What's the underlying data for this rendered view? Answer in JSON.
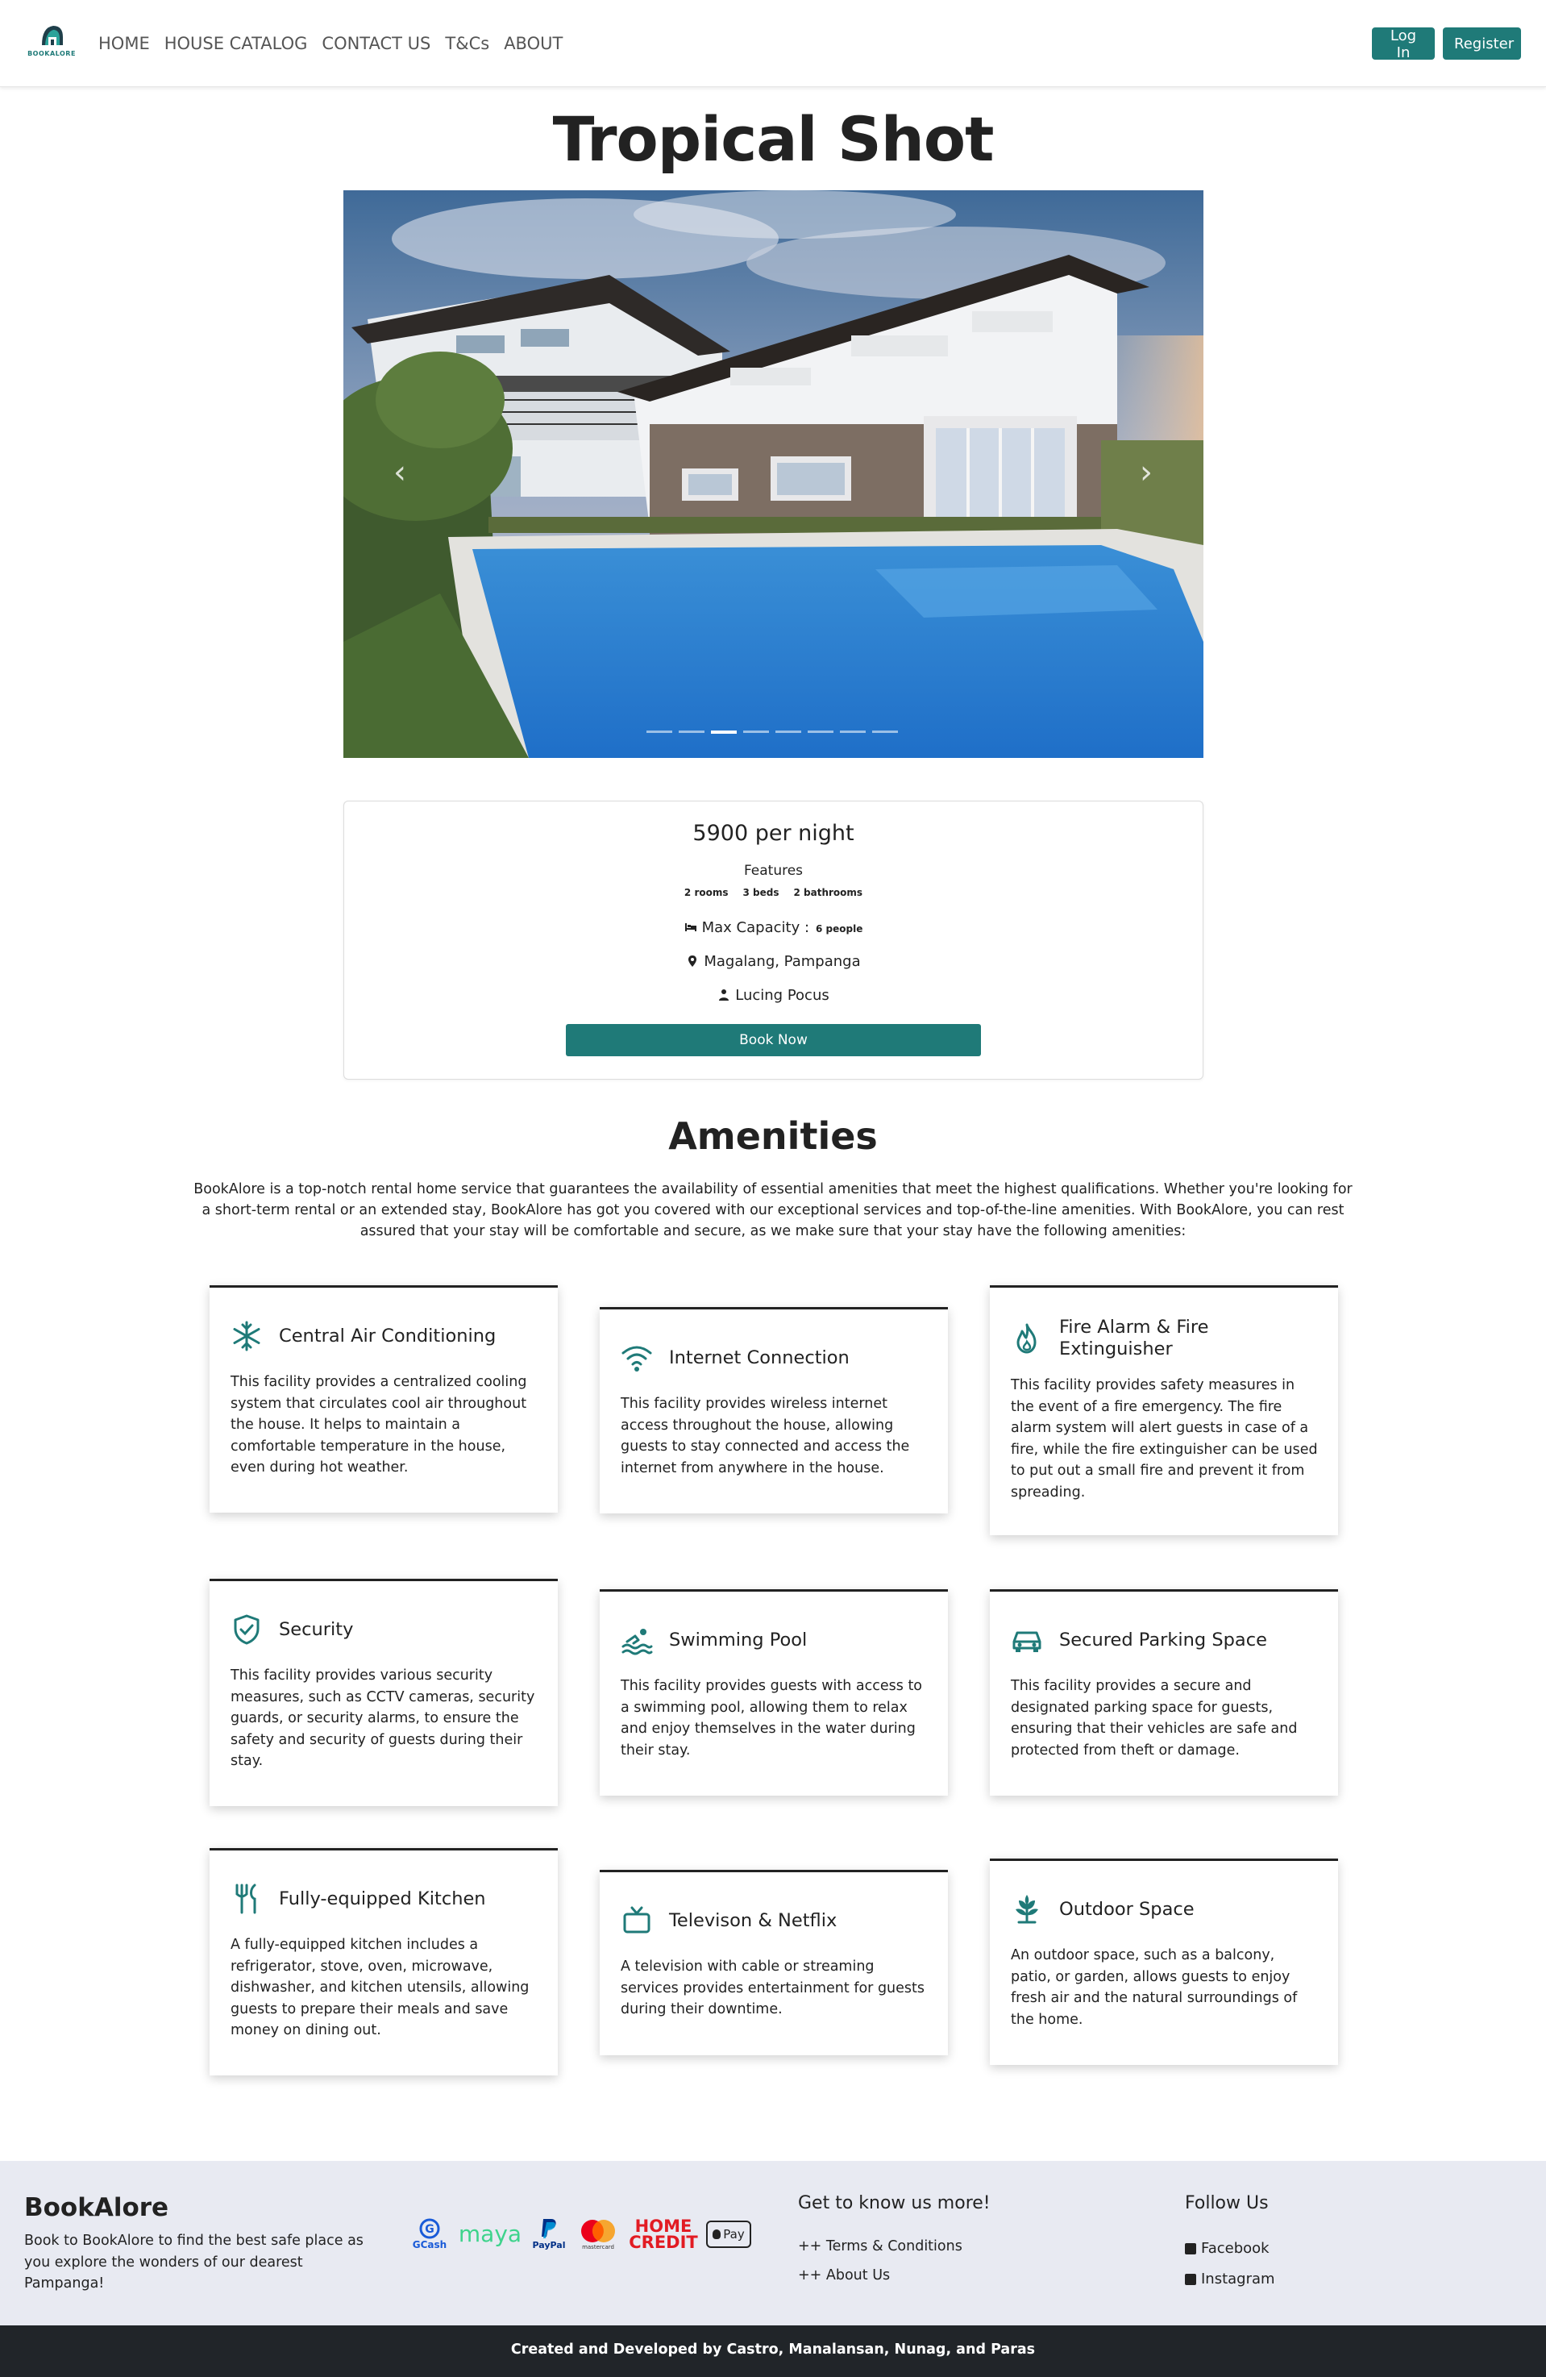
{
  "navbar": {
    "brand": "BOOKALORE",
    "links": [
      "HOME",
      "HOUSE CATALOG",
      "CONTACT US",
      "T&Cs",
      "ABOUT"
    ],
    "login": "Log In",
    "register": "Register"
  },
  "house": {
    "title": "Tropical Shot",
    "carousel": {
      "slides": 8,
      "active_index": 2
    },
    "price": "5900 per night",
    "features_label": "Features",
    "features": [
      "2 rooms",
      "3 beds",
      "2 bathrooms"
    ],
    "capacity_label": "Max Capacity :",
    "capacity_value": "6 people",
    "location": "Magalang, Pampanga",
    "host": "Lucing Pocus",
    "book_button": "Book Now"
  },
  "amenities": {
    "title": "Amenities",
    "intro": "BookAlore is a top-notch rental home service that guarantees the availability of essential amenities that meet the highest qualifications. Whether you're looking for a short-term rental or an extended stay, BookAlore has got you covered with our exceptional services and top-of-the-line amenities. With BookAlore, you can rest assured that your stay will be comfortable and secure, as we make sure that your stay have the following amenities:",
    "items": [
      {
        "icon": "snowflake-icon",
        "title": "Central Air Conditioning",
        "text": "This facility provides a centralized cooling system that circulates cool air throughout the house. It helps to maintain a comfortable temperature in the house, even during hot weather."
      },
      {
        "icon": "wifi-icon",
        "title": "Internet Connection",
        "text": "This facility provides wireless internet access throughout the house, allowing guests to stay connected and access the internet from anywhere in the house."
      },
      {
        "icon": "fire-icon",
        "title": "Fire Alarm & Fire Extinguisher",
        "text": "This facility provides safety measures in the event of a fire emergency. The fire alarm system will alert guests in case of a fire, while the fire extinguisher can be used to put out a small fire and prevent it from spreading."
      },
      {
        "icon": "shield-check-icon",
        "title": "Security",
        "text": "This facility provides various security measures, such as CCTV cameras, security guards, or security alarms, to ensure the safety and security of guests during their stay."
      },
      {
        "icon": "swimming-icon",
        "title": "Swimming Pool",
        "text": "This facility provides guests with access to a swimming pool, allowing them to relax and enjoy themselves in the water during their stay."
      },
      {
        "icon": "car-icon",
        "title": "Secured Parking Space",
        "text": "This facility provides a secure and designated parking space for guests, ensuring that their vehicles are safe and protected from theft or damage."
      },
      {
        "icon": "utensils-icon",
        "title": "Fully-equipped Kitchen",
        "text": "A fully-equipped kitchen includes a refrigerator, stove, oven, microwave, dishwasher, and kitchen utensils, allowing guests to prepare their meals and save money on dining out."
      },
      {
        "icon": "tv-icon",
        "title": "Televison & Netflix",
        "text": "A television with cable or streaming services provides entertainment for guests during their downtime."
      },
      {
        "icon": "plant-icon",
        "title": "Outdoor Space",
        "text": "An outdoor space, such as a balcony, patio, or garden, allows guests to enjoy fresh air and the natural surroundings of the home."
      }
    ]
  },
  "footer": {
    "brand": "BookAlore",
    "description": "Book to BookAlore to find the best safe place as you explore the wonders of our dearest Pampanga!",
    "payments": {
      "gcash": "GCash",
      "maya": "maya",
      "paypal": "PayPal",
      "mastercard": "mastercard",
      "homecredit_1": "HOME",
      "homecredit_2": "CREDIT",
      "applepay": "Pay"
    },
    "know_title": "Get to know us more!",
    "links": [
      "++ Terms & Conditions",
      "++ About Us"
    ],
    "follow_title": "Follow Us",
    "social": [
      "Facebook",
      "Instagram"
    ],
    "credits": "Created and Developed by Castro, Manalansan, Nunag, and Paras"
  },
  "colors": {
    "accent": "#1f7a78",
    "dark": "#212529",
    "footer_bg": "#e8eaf2"
  }
}
